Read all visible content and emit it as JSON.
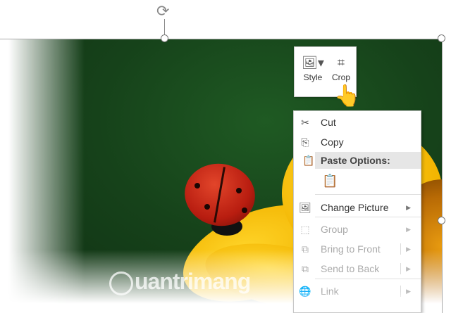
{
  "watermark": "uantrimang",
  "mini_toolbar": {
    "style_label": "Style",
    "crop_label": "Crop"
  },
  "context_menu": {
    "cut": "Cut",
    "copy": "Copy",
    "paste_header": "Paste Options:",
    "change_picture": "Change Picture",
    "group": "Group",
    "bring_to_front": "Bring to Front",
    "send_to_back": "Send to Back",
    "link": "Link"
  }
}
